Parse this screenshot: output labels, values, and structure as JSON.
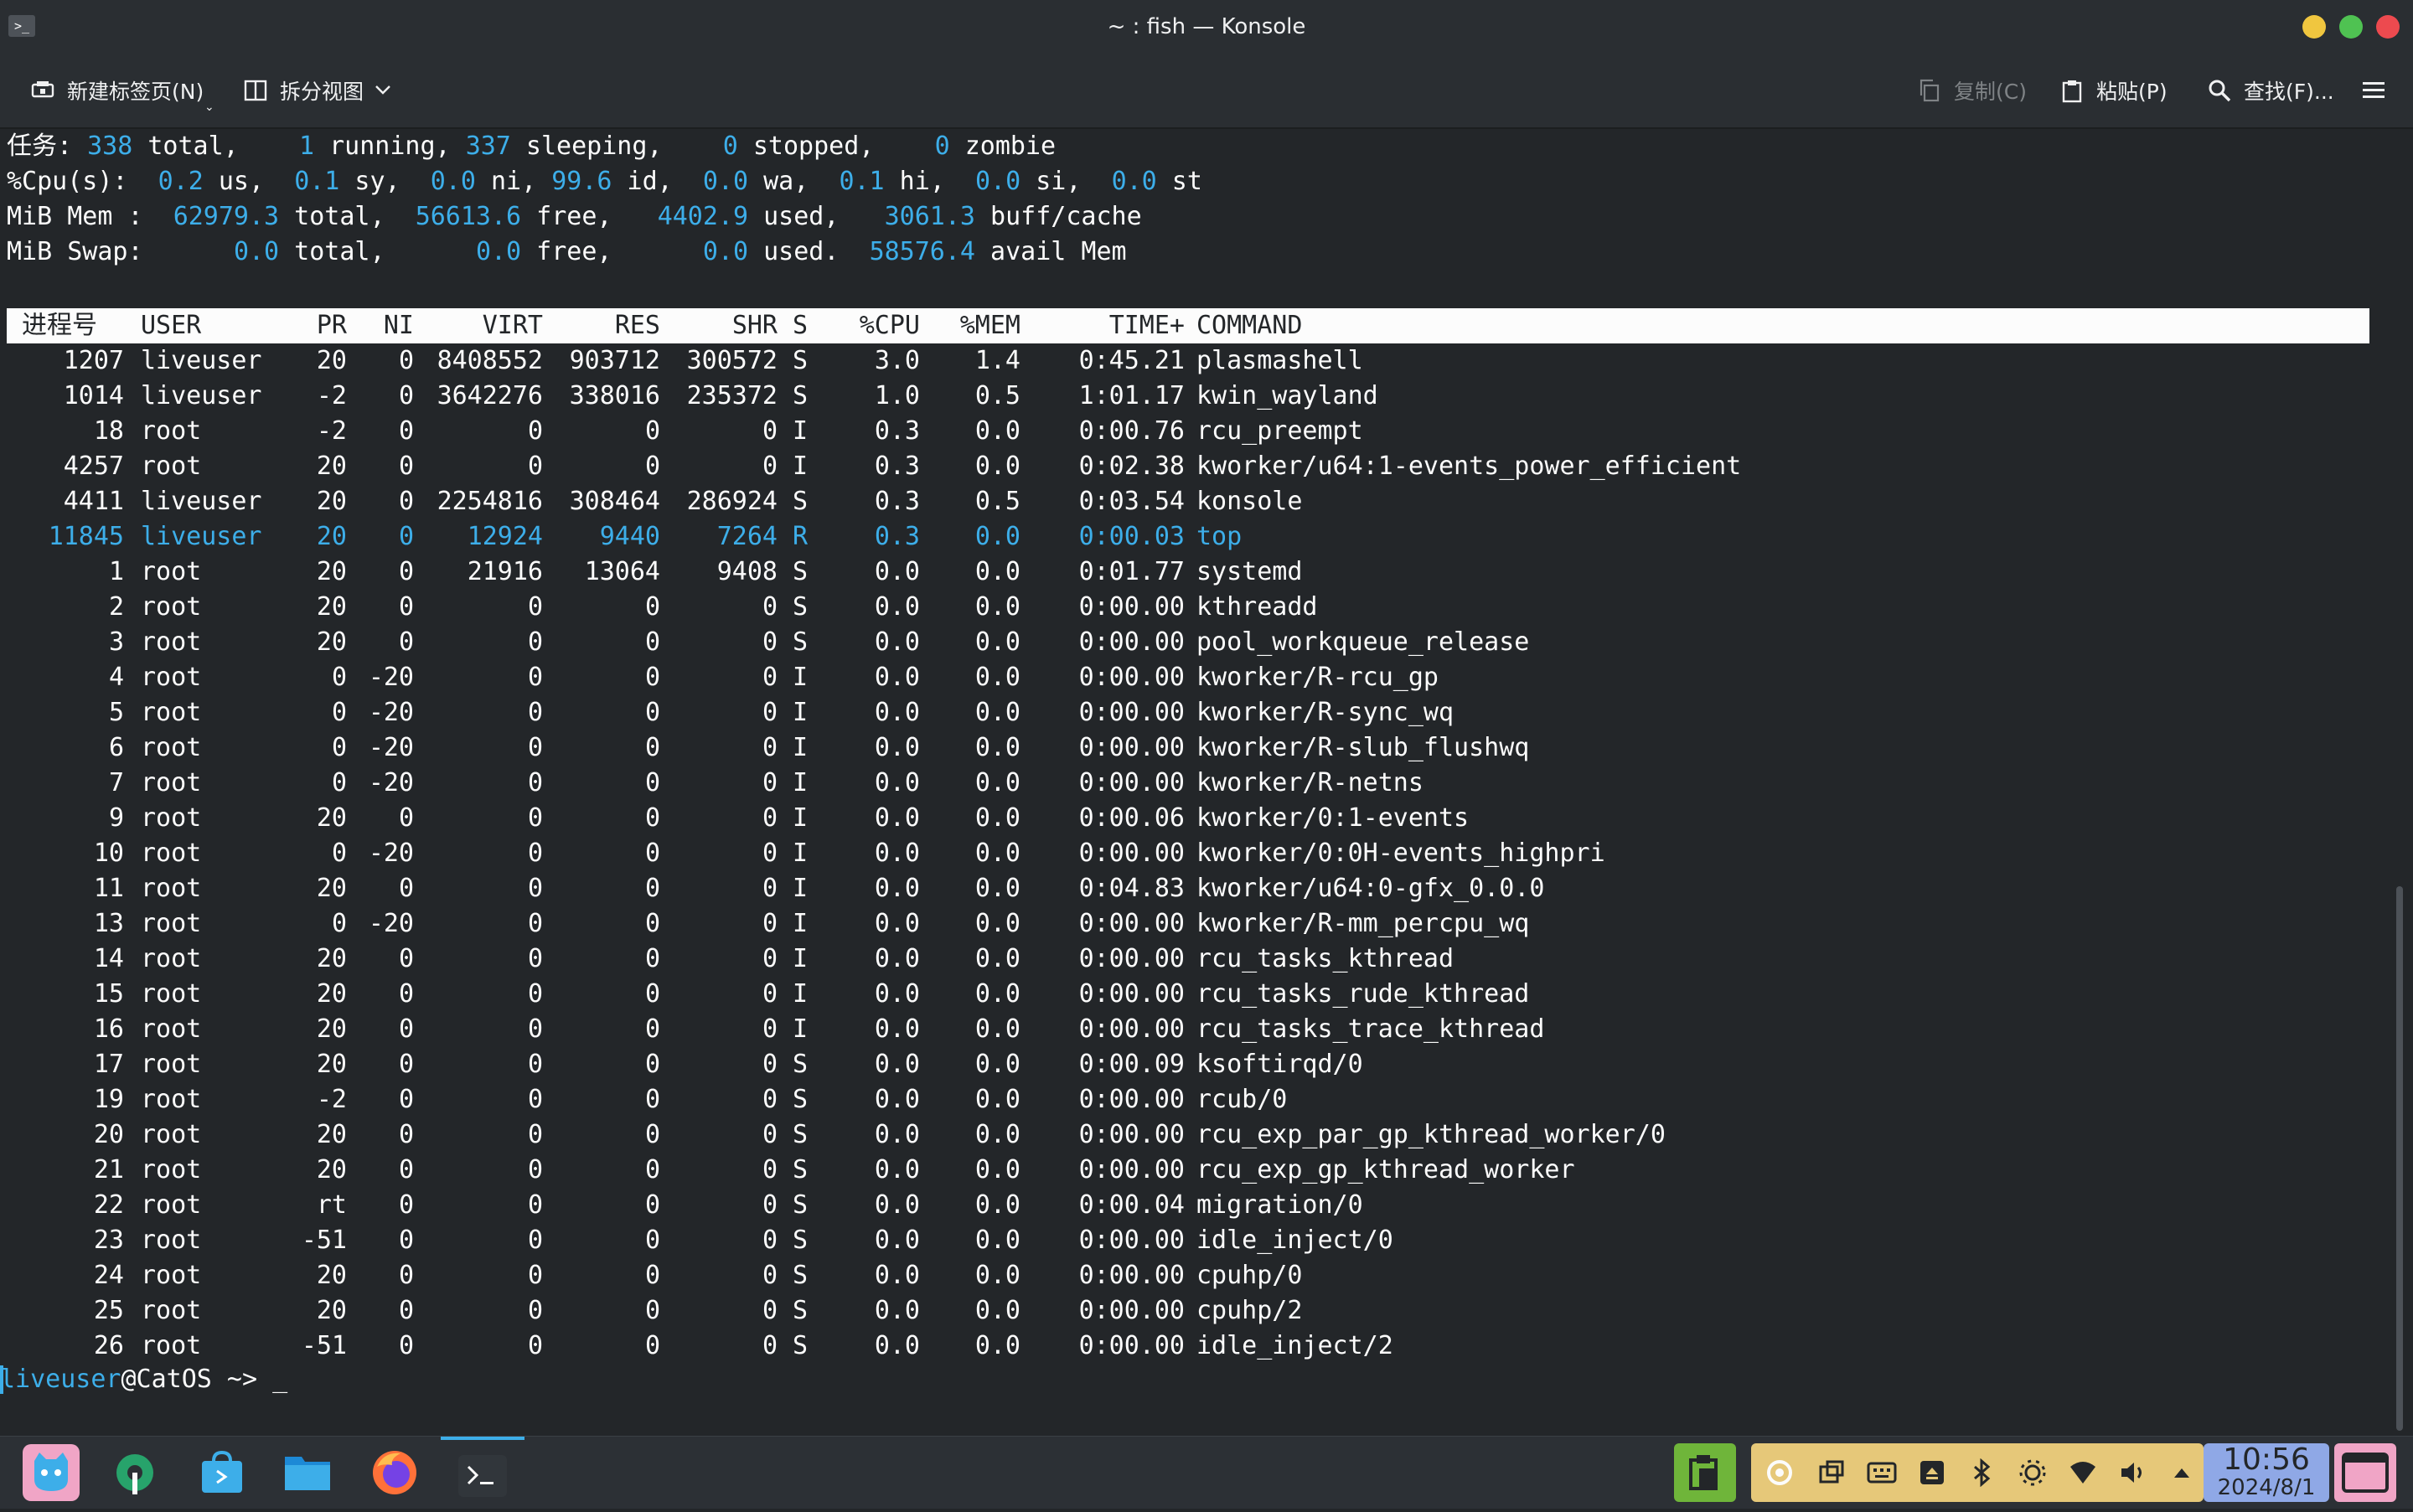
{
  "window": {
    "title": "~ : fish — Konsole",
    "app_icon_glyph": ">_"
  },
  "toolbar": {
    "new_tab": "新建标签页(N)",
    "split_view": "拆分视图",
    "copy": "复制(C)",
    "paste": "粘贴(P)",
    "find": "查找(F)..."
  },
  "top": {
    "tasks": {
      "label": "任务:",
      "total": "338",
      "running": "1",
      "sleeping": "337",
      "stopped": "0",
      "zombie": "0"
    },
    "cpu": {
      "label": "%Cpu(s):",
      "us": "0.2",
      "sy": "0.1",
      "ni": "0.0",
      "id": "99.6",
      "wa": "0.0",
      "hi": "0.1",
      "si": "0.0",
      "st": "0.0"
    },
    "mem": {
      "label": "MiB Mem :",
      "total": "62979.3",
      "free": "56613.6",
      "used": "4402.9",
      "buff": "3061.3"
    },
    "swap": {
      "label": "MiB Swap:",
      "total": "0.0",
      "free": "0.0",
      "used": "0.0",
      "avail": "58576.4"
    },
    "headers": [
      "进程号",
      "USER",
      "PR",
      "NI",
      "VIRT",
      "RES",
      "SHR",
      "S",
      "%CPU",
      "%MEM",
      "TIME+",
      "COMMAND"
    ],
    "processes": [
      [
        "1207",
        "liveuser",
        "20",
        "0",
        "8408552",
        "903712",
        "300572",
        "S",
        "3.0",
        "1.4",
        "0:45.21",
        "plasmashell"
      ],
      [
        "1014",
        "liveuser",
        "-2",
        "0",
        "3642276",
        "338016",
        "235372",
        "S",
        "1.0",
        "0.5",
        "1:01.17",
        "kwin_wayland"
      ],
      [
        "18",
        "root",
        "-2",
        "0",
        "0",
        "0",
        "0",
        "I",
        "0.3",
        "0.0",
        "0:00.76",
        "rcu_preempt"
      ],
      [
        "4257",
        "root",
        "20",
        "0",
        "0",
        "0",
        "0",
        "I",
        "0.3",
        "0.0",
        "0:02.38",
        "kworker/u64:1-events_power_efficient"
      ],
      [
        "4411",
        "liveuser",
        "20",
        "0",
        "2254816",
        "308464",
        "286924",
        "S",
        "0.3",
        "0.5",
        "0:03.54",
        "konsole"
      ],
      [
        "11845",
        "liveuser",
        "20",
        "0",
        "12924",
        "9440",
        "7264",
        "R",
        "0.3",
        "0.0",
        "0:00.03",
        "top"
      ],
      [
        "1",
        "root",
        "20",
        "0",
        "21916",
        "13064",
        "9408",
        "S",
        "0.0",
        "0.0",
        "0:01.77",
        "systemd"
      ],
      [
        "2",
        "root",
        "20",
        "0",
        "0",
        "0",
        "0",
        "S",
        "0.0",
        "0.0",
        "0:00.00",
        "kthreadd"
      ],
      [
        "3",
        "root",
        "20",
        "0",
        "0",
        "0",
        "0",
        "S",
        "0.0",
        "0.0",
        "0:00.00",
        "pool_workqueue_release"
      ],
      [
        "4",
        "root",
        "0",
        "-20",
        "0",
        "0",
        "0",
        "I",
        "0.0",
        "0.0",
        "0:00.00",
        "kworker/R-rcu_gp"
      ],
      [
        "5",
        "root",
        "0",
        "-20",
        "0",
        "0",
        "0",
        "I",
        "0.0",
        "0.0",
        "0:00.00",
        "kworker/R-sync_wq"
      ],
      [
        "6",
        "root",
        "0",
        "-20",
        "0",
        "0",
        "0",
        "I",
        "0.0",
        "0.0",
        "0:00.00",
        "kworker/R-slub_flushwq"
      ],
      [
        "7",
        "root",
        "0",
        "-20",
        "0",
        "0",
        "0",
        "I",
        "0.0",
        "0.0",
        "0:00.00",
        "kworker/R-netns"
      ],
      [
        "9",
        "root",
        "20",
        "0",
        "0",
        "0",
        "0",
        "I",
        "0.0",
        "0.0",
        "0:00.06",
        "kworker/0:1-events"
      ],
      [
        "10",
        "root",
        "0",
        "-20",
        "0",
        "0",
        "0",
        "I",
        "0.0",
        "0.0",
        "0:00.00",
        "kworker/0:0H-events_highpri"
      ],
      [
        "11",
        "root",
        "20",
        "0",
        "0",
        "0",
        "0",
        "I",
        "0.0",
        "0.0",
        "0:04.83",
        "kworker/u64:0-gfx_0.0.0"
      ],
      [
        "13",
        "root",
        "0",
        "-20",
        "0",
        "0",
        "0",
        "I",
        "0.0",
        "0.0",
        "0:00.00",
        "kworker/R-mm_percpu_wq"
      ],
      [
        "14",
        "root",
        "20",
        "0",
        "0",
        "0",
        "0",
        "I",
        "0.0",
        "0.0",
        "0:00.00",
        "rcu_tasks_kthread"
      ],
      [
        "15",
        "root",
        "20",
        "0",
        "0",
        "0",
        "0",
        "I",
        "0.0",
        "0.0",
        "0:00.00",
        "rcu_tasks_rude_kthread"
      ],
      [
        "16",
        "root",
        "20",
        "0",
        "0",
        "0",
        "0",
        "I",
        "0.0",
        "0.0",
        "0:00.00",
        "rcu_tasks_trace_kthread"
      ],
      [
        "17",
        "root",
        "20",
        "0",
        "0",
        "0",
        "0",
        "S",
        "0.0",
        "0.0",
        "0:00.09",
        "ksoftirqd/0"
      ],
      [
        "19",
        "root",
        "-2",
        "0",
        "0",
        "0",
        "0",
        "S",
        "0.0",
        "0.0",
        "0:00.00",
        "rcub/0"
      ],
      [
        "20",
        "root",
        "20",
        "0",
        "0",
        "0",
        "0",
        "S",
        "0.0",
        "0.0",
        "0:00.00",
        "rcu_exp_par_gp_kthread_worker/0"
      ],
      [
        "21",
        "root",
        "20",
        "0",
        "0",
        "0",
        "0",
        "S",
        "0.0",
        "0.0",
        "0:00.00",
        "rcu_exp_gp_kthread_worker"
      ],
      [
        "22",
        "root",
        "rt",
        "0",
        "0",
        "0",
        "0",
        "S",
        "0.0",
        "0.0",
        "0:00.04",
        "migration/0"
      ],
      [
        "23",
        "root",
        "-51",
        "0",
        "0",
        "0",
        "0",
        "S",
        "0.0",
        "0.0",
        "0:00.00",
        "idle_inject/0"
      ],
      [
        "24",
        "root",
        "20",
        "0",
        "0",
        "0",
        "0",
        "S",
        "0.0",
        "0.0",
        "0:00.00",
        "cpuhp/0"
      ],
      [
        "25",
        "root",
        "20",
        "0",
        "0",
        "0",
        "0",
        "S",
        "0.0",
        "0.0",
        "0:00.00",
        "cpuhp/2"
      ],
      [
        "26",
        "root",
        "-51",
        "0",
        "0",
        "0",
        "0",
        "S",
        "0.0",
        "0.0",
        "0:00.00",
        "idle_inject/2"
      ]
    ],
    "highlight_pid": "11845"
  },
  "prompt": {
    "user": "liveuser",
    "host": "@CatOS",
    "path": " ~> ",
    "cursor": "_"
  },
  "taskbar": {
    "apps": [
      "catos-launcher-icon",
      "system-settings-icon",
      "store-icon",
      "file-manager-icon",
      "firefox-icon",
      "terminal-icon"
    ],
    "time": "10:56",
    "date": "2024/8/1"
  },
  "colors": {
    "accent": "#3daee9",
    "bg": "#232629",
    "fg": "#fcfcfc"
  }
}
